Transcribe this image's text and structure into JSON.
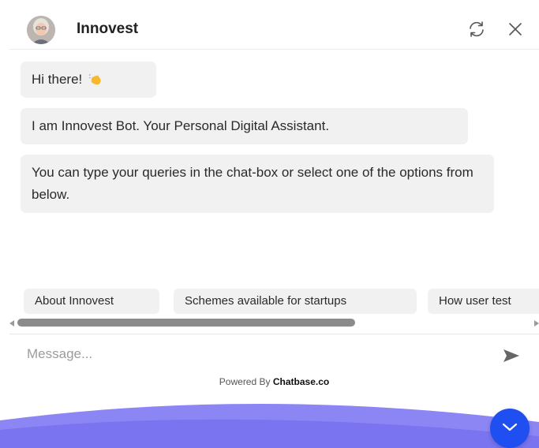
{
  "header": {
    "bot_name": "Innovest",
    "avatar_icon": "bot-avatar-photo",
    "refresh_icon": "refresh-icon",
    "close_icon": "close-icon"
  },
  "messages": [
    {
      "from": "bot",
      "text": "Hi there!",
      "emoji_icon": "waving-hand-icon"
    },
    {
      "from": "bot",
      "text": "I am Innovest Bot. Your Personal Digital Assistant."
    },
    {
      "from": "bot",
      "text": "You can type your queries in the chat-box or select one of the options from below."
    }
  ],
  "quick_replies": [
    "About Innovest",
    "Schemes available for startups",
    "How user test"
  ],
  "composer": {
    "placeholder": "Message...",
    "send_icon": "send-icon"
  },
  "footer": {
    "powered_prefix": "Powered By ",
    "powered_brand": "Chatbase.co"
  },
  "launcher": {
    "icon": "chevron-down-icon"
  },
  "colors": {
    "accent": "#1f4ff0",
    "bubble_bg": "#f1f1f2",
    "brand_wave": "#7f7cf4"
  }
}
